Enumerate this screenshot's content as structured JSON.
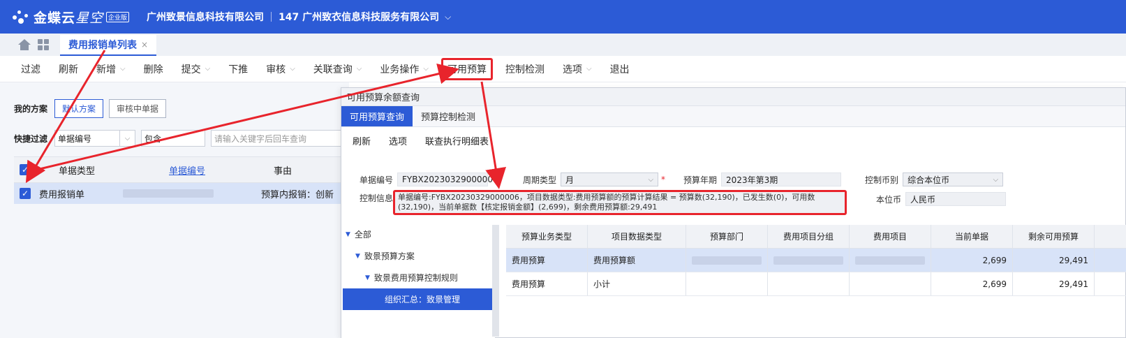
{
  "app": {
    "brand": "金蝶云",
    "brand_star": "星空",
    "edition_badge": "企业版",
    "org_primary": "广州致景信息科技有限公司",
    "org_secondary": "147 广州致衣信息科技服务有限公司"
  },
  "tabs": {
    "doc_tab_label": "费用报销单列表",
    "close_symbol": "×"
  },
  "toolbar": {
    "items": [
      {
        "label": "过滤",
        "has_caret": false
      },
      {
        "label": "刷新",
        "has_caret": false
      },
      {
        "label": "新增",
        "has_caret": true
      },
      {
        "label": "删除",
        "has_caret": false
      },
      {
        "label": "提交",
        "has_caret": true
      },
      {
        "label": "下推",
        "has_caret": false
      },
      {
        "label": "审核",
        "has_caret": true
      },
      {
        "label": "关联查询",
        "has_caret": true
      },
      {
        "label": "业务操作",
        "has_caret": true
      },
      {
        "label": "可用预算",
        "has_caret": false,
        "highlighted": true
      },
      {
        "label": "控制检测",
        "has_caret": false
      },
      {
        "label": "选项",
        "has_caret": true
      },
      {
        "label": "退出",
        "has_caret": false
      }
    ]
  },
  "left": {
    "plan_label": "我的方案",
    "plan_default": "默认方案",
    "plan_pending": "审核中单据",
    "filter_label": "快捷过滤",
    "filter_field": "单据编号",
    "filter_op": "包含",
    "filter_placeholder": "请输入关键字后回车查询",
    "columns": [
      "单据类型",
      "单据编号",
      "事由"
    ],
    "row": {
      "type": "费用报销单",
      "reason": "预算内报销：创新"
    }
  },
  "dialog": {
    "title": "可用预算余额查询",
    "tabs": [
      "可用预算查询",
      "预算控制检测"
    ],
    "actions": [
      "刷新",
      "选项",
      "联查执行明细表"
    ],
    "form": {
      "bill_no_label": "单据编号",
      "bill_no_value": "FYBX20230329000006",
      "period_type_label": "周期类型",
      "period_type_value": "月",
      "budget_period_label": "预算年期",
      "budget_period_value": "2023年第3期",
      "ctrl_currency_label": "控制币别",
      "ctrl_currency_value": "综合本位币",
      "ctrl_info_label": "控制信息",
      "ctrl_info_value": "单据编号:FYBX20230329000006，项目数据类型:费用预算额的预算计算结果 = 预算数(32,190)，已发生数(0)，可用数(32,190)，当前单据数【核定报销金额】(2,699)，剩余费用预算额:29,491",
      "base_currency_label": "本位币",
      "base_currency_value": "人民币"
    },
    "tree": [
      {
        "label": "全部",
        "level": 0,
        "selected": false
      },
      {
        "label": "致景预算方案",
        "level": 1,
        "selected": false
      },
      {
        "label": "致景费用预算控制规则",
        "level": 2,
        "selected": false
      },
      {
        "label": "组织汇总：致景管理",
        "level": 3,
        "selected": true
      }
    ],
    "table": {
      "columns": [
        "预算业务类型",
        "项目数据类型",
        "预算部门",
        "费用项目分组",
        "费用项目",
        "当前单据",
        "剩余可用预算"
      ],
      "rows": [
        {
          "biz_type": "费用预算",
          "data_type": "费用预算额",
          "current": "2,699",
          "remaining": "29,491",
          "selected": true
        },
        {
          "biz_type": "费用预算",
          "data_type": "小计",
          "current": "2,699",
          "remaining": "29,491",
          "selected": false
        }
      ]
    }
  },
  "colors": {
    "brand_blue": "#2c5bd6",
    "annotation_red": "#e8242c"
  }
}
